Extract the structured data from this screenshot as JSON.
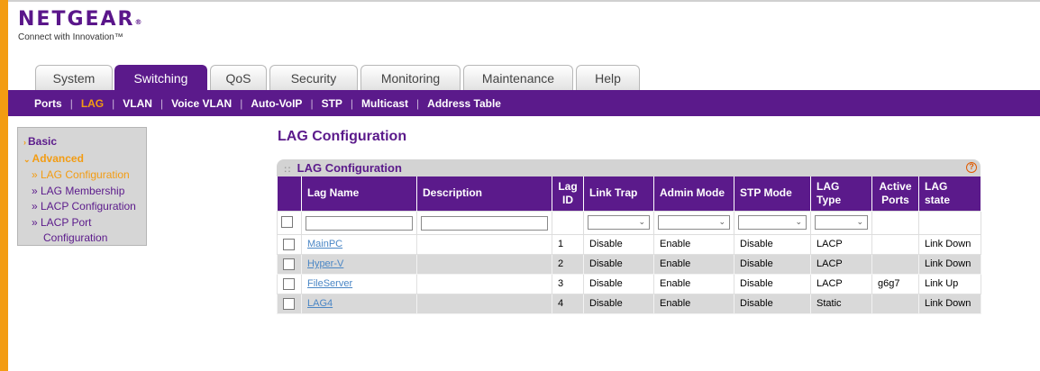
{
  "brand": {
    "name": "NETGEAR",
    "reg": "®",
    "tagline": "Connect with Innovation™"
  },
  "tabs": [
    {
      "label": "System"
    },
    {
      "label": "Switching"
    },
    {
      "label": "QoS"
    },
    {
      "label": "Security"
    },
    {
      "label": "Monitoring"
    },
    {
      "label": "Maintenance"
    },
    {
      "label": "Help"
    }
  ],
  "subnav": [
    {
      "label": "Ports"
    },
    {
      "label": "LAG"
    },
    {
      "label": "VLAN"
    },
    {
      "label": "Voice VLAN"
    },
    {
      "label": "Auto-VoIP"
    },
    {
      "label": "STP"
    },
    {
      "label": "Multicast"
    },
    {
      "label": "Address Table"
    }
  ],
  "sidebar": {
    "basic": "Basic",
    "advanced": "Advanced",
    "items": [
      {
        "label": "» LAG Configuration"
      },
      {
        "label": "» LAG Membership"
      },
      {
        "label": "» LACP Configuration"
      },
      {
        "label": "» LACP Port"
      },
      {
        "label": "Configuration"
      }
    ]
  },
  "page": {
    "title": "LAG Configuration"
  },
  "panel": {
    "title": "LAG Configuration",
    "help": "?",
    "columns": [
      "Lag Name",
      "Description",
      "Lag ID",
      "Link Trap",
      "Admin Mode",
      "STP Mode",
      "LAG Type",
      "Active Ports",
      "LAG state"
    ],
    "rows": [
      {
        "name": "MainPC",
        "desc": "",
        "id": "1",
        "trap": "Disable",
        "admin": "Enable",
        "stp": "Disable",
        "type": "LACP",
        "ports": "",
        "state": "Link Down"
      },
      {
        "name": "Hyper-V",
        "desc": "",
        "id": "2",
        "trap": "Disable",
        "admin": "Enable",
        "stp": "Disable",
        "type": "LACP",
        "ports": "",
        "state": "Link Down"
      },
      {
        "name": "FileServer",
        "desc": "",
        "id": "3",
        "trap": "Disable",
        "admin": "Enable",
        "stp": "Disable",
        "type": "LACP",
        "ports": "g6g7",
        "state": "Link Up"
      },
      {
        "name": "LAG4",
        "desc": "",
        "id": "4",
        "trap": "Disable",
        "admin": "Enable",
        "stp": "Disable",
        "type": "Static",
        "ports": "",
        "state": "Link Down"
      }
    ]
  },
  "colors": {
    "purple": "#5b1a8b",
    "orange": "#f39c12"
  }
}
